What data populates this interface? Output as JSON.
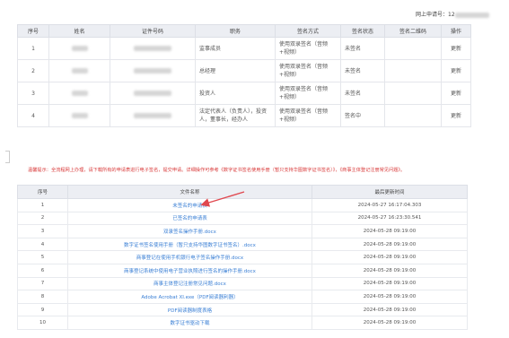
{
  "header": {
    "online_no_label": "网上申请号：12"
  },
  "signers": {
    "columns": [
      "序号",
      "姓名",
      "证件号码",
      "职务",
      "签名方式",
      "签名状态",
      "签名二维码",
      "操作"
    ],
    "rows": [
      {
        "no": "1",
        "role": "监事成员",
        "method": "使用双录签名（音频+视频）",
        "status": "未签名",
        "action": "更新"
      },
      {
        "no": "2",
        "role": "总经理",
        "method": "使用双录签名（音频+视频）",
        "status": "未签名",
        "action": "更新"
      },
      {
        "no": "3",
        "role": "投资人",
        "method": "使用双录签名（音频+视频）",
        "status": "未签名",
        "action": "更新"
      },
      {
        "no": "4",
        "role": "法定代表人（负责人），投资人，董事长，经办人",
        "method": "使用双录签名（音频+视频）",
        "status": "签名中",
        "action": "更新"
      }
    ]
  },
  "notice": "温馨提示：全流程网上办理，请下载所有的申请表进行电子签名，提交申请。详细操作可参考《数字证书签名使用手册（暂只支持华图数字证书签名）》，《商事主体登记注册常见问题》。",
  "files": {
    "columns": [
      "序号",
      "文件名称",
      "最后更新时间"
    ],
    "rows": [
      {
        "no": "1",
        "name": "未签名的申请表",
        "time": "2024-05-27 16:17:04.303"
      },
      {
        "no": "2",
        "name": "已签名的申请表",
        "time": "2024-05-27 16:23:30.541"
      },
      {
        "no": "3",
        "name": "双录签名操作手册.docx",
        "time": "2024-05-28 09:19:00"
      },
      {
        "no": "4",
        "name": "数字证书签名使用手册（暂只支持华图数字证书签名）.docx",
        "time": "2024-05-28 09:19:00"
      },
      {
        "no": "5",
        "name": "商事登记在使用手机银行电子签名操作手册.docx",
        "time": "2024-05-28 09:19:00"
      },
      {
        "no": "6",
        "name": "商事登记系统中使用电子营业执照进行签名的操作手册.docx",
        "time": "2024-05-28 09:19:00"
      },
      {
        "no": "7",
        "name": "商事主体登记注册常见问题.docx",
        "time": "2024-05-28 09:19:00"
      },
      {
        "no": "8",
        "name": "Adobe Acrobat XI.exe（PDF阅读器利器）",
        "time": "2024-05-28 09:19:00"
      },
      {
        "no": "9",
        "name": "PDF阅读器制度表格",
        "time": "2024-05-28 09:19:00"
      },
      {
        "no": "10",
        "name": "数字证书驱动下载",
        "time": "2024-05-28 09:19:00"
      }
    ]
  },
  "colors": {
    "link": "#3a7fd5",
    "notice": "#d93a3a",
    "arrow": "#e0484f",
    "header_bg": "#eceef3"
  }
}
